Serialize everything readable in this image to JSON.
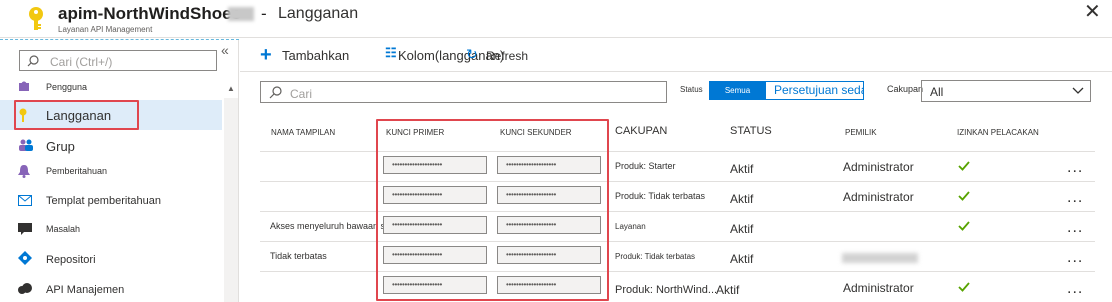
{
  "header": {
    "resource_name": "apim-NorthWindShoes",
    "separator": "-",
    "page_title": "Langganan",
    "subtitle": "Layanan API Management",
    "close_glyph": "✕",
    "key_icon": "key-icon"
  },
  "sidebar": {
    "collapse_glyph": "«",
    "search_placeholder": "Cari (Ctrl+/)",
    "items": [
      {
        "label": "Pengguna",
        "icon": "users-icon"
      },
      {
        "label": "Langganan",
        "icon": "key-icon",
        "active": true
      },
      {
        "label": "Grup",
        "icon": "group-icon"
      },
      {
        "label": "Pemberitahuan",
        "icon": "bell-icon"
      },
      {
        "label": "Templat pemberitahuan",
        "icon": "mail-icon"
      },
      {
        "label": "Masalah",
        "icon": "chat-icon"
      },
      {
        "label": "Repositori",
        "icon": "repository-icon"
      },
      {
        "label": "API Manajemen",
        "icon": "cloud-icon"
      }
    ]
  },
  "toolbar": {
    "add_label": "Tambahkan",
    "columns_label": "Kolom(langganan)",
    "refresh_label": "Refresh"
  },
  "filters": {
    "search_placeholder": "Cari",
    "status_label": "Status",
    "status_all": "Semua",
    "status_other": "Persetujuan sedang diproses",
    "scope_label": "Cakupan",
    "scope_value": "All"
  },
  "table": {
    "headers": {
      "name": "NAMA TAMPILAN",
      "primary": "KUNCI PRIMER",
      "secondary": "KUNCI SEKUNDER",
      "scope": "CAKUPAN",
      "status": "STATUS",
      "owner": "PEMILIK",
      "tracing": "IZINKAN PELACAKAN"
    },
    "rows": [
      {
        "name": "",
        "primary": "••••••••••••••••••••",
        "secondary": "••••••••••••••••••••",
        "scope": "Produk: Starter",
        "status": "Aktif",
        "owner": "Administrator",
        "tracing": true
      },
      {
        "name": "",
        "primary": "••••••••••••••••••••",
        "secondary": "••••••••••••••••••••",
        "scope": "Produk: Tidak terbatas",
        "status": "Aktif",
        "owner": "Administrator",
        "tracing": true
      },
      {
        "name": "Akses menyeluruh bawaan su...",
        "primary": "••••••••••••••••••••",
        "secondary": "••••••••••••••••••••",
        "scope": "Layanan",
        "status": "Aktif",
        "owner": "",
        "tracing": true
      },
      {
        "name": "Tidak terbatas",
        "primary": "••••••••••••••••••••",
        "secondary": "••••••••••••••••••••",
        "scope": "Produk: Tidak terbatas",
        "status": "Aktif",
        "owner": "",
        "tracing": false
      },
      {
        "name": "",
        "primary": "••••••••••••••••••••",
        "secondary": "••••••••••••••••••••",
        "scope": "Produk: NorthWind...",
        "status": "Aktif",
        "owner": "Administrator",
        "tracing": true
      }
    ],
    "more_glyph": "..."
  },
  "colors": {
    "accent": "#0078d4",
    "highlight_border": "#e0464e",
    "active_bg": "#deecf9",
    "check": "#57a300"
  }
}
